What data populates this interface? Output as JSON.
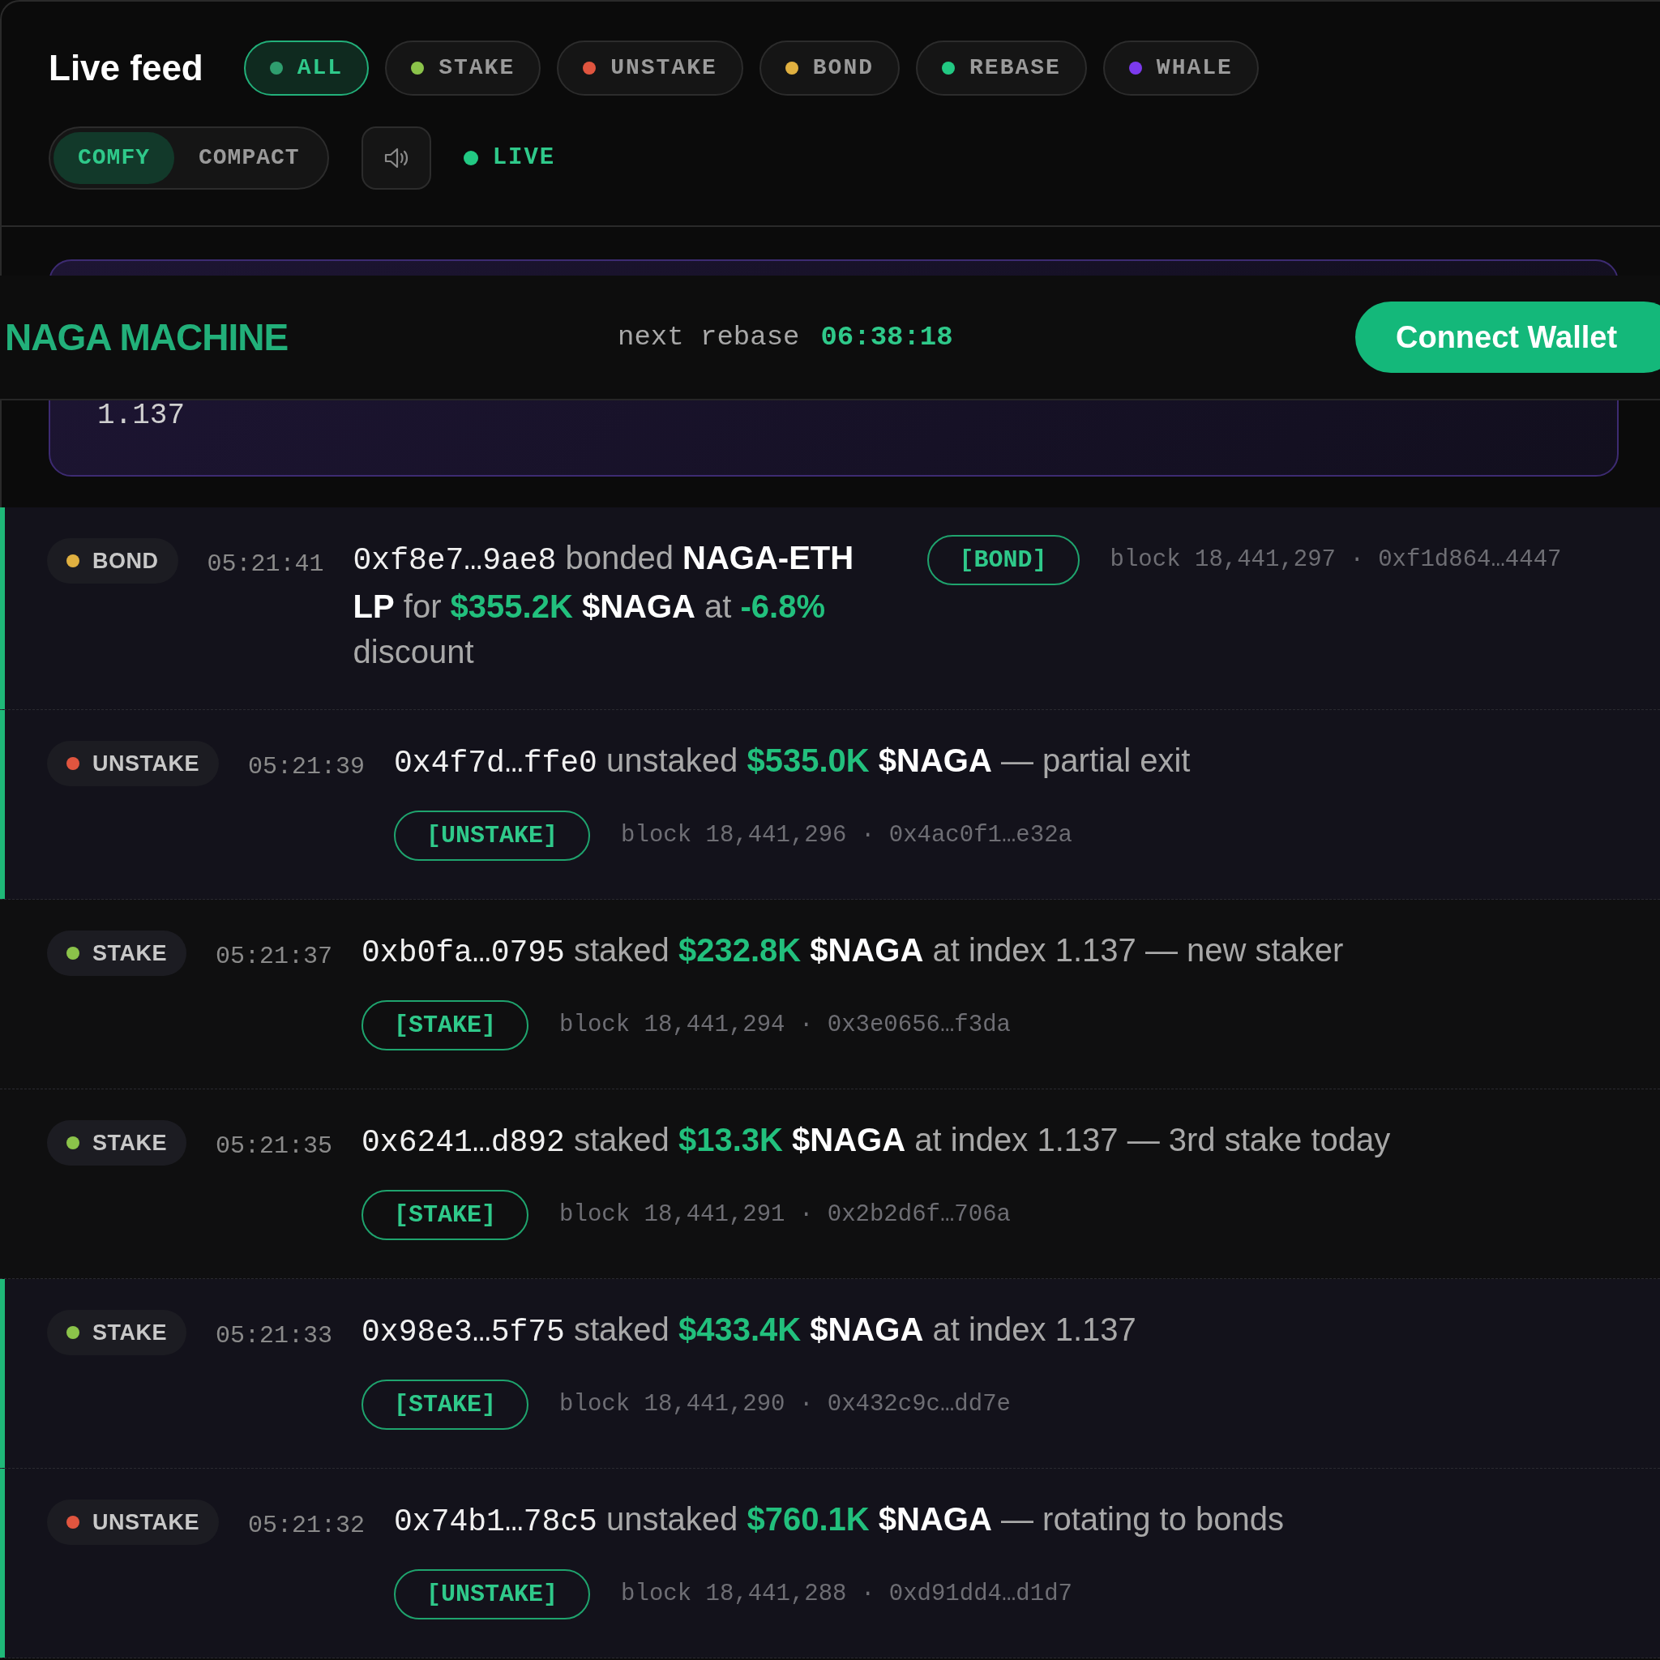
{
  "header": {
    "title": "Live feed",
    "filters": [
      {
        "label": "ALL",
        "color": "#2f9e6e",
        "selected": true
      },
      {
        "label": "STAKE",
        "color": "#8bc34a",
        "selected": false
      },
      {
        "label": "UNSTAKE",
        "color": "#e0553f",
        "selected": false
      },
      {
        "label": "BOND",
        "color": "#e0b040",
        "selected": false
      },
      {
        "label": "REBASE",
        "color": "#22c983",
        "selected": false
      },
      {
        "label": "WHALE",
        "color": "#7c3aed",
        "selected": false
      }
    ],
    "density": [
      {
        "label": "COMFY",
        "selected": true
      },
      {
        "label": "COMPACT",
        "selected": false
      }
    ],
    "live": {
      "label": "LIVE",
      "on": true
    }
  },
  "topbar": {
    "brand": "NAGA MACHINE",
    "rebase_label": "next rebase",
    "rebase_time": "06:38:18",
    "button": "Connect Wallet"
  },
  "index_card": {
    "value": "1.137"
  },
  "events": [
    {
      "type": "BOND",
      "color": "#e0b040",
      "time": "05:21:41",
      "highlighted": true,
      "kind": "inline",
      "tag": "[BOND]",
      "meta": "block 18,441,297 · 0xf1d864…4447",
      "parts": [
        {
          "kind": "addr",
          "text": "0xf8e7…9ae8"
        },
        {
          "kind": "text",
          "text": " bonded "
        },
        {
          "kind": "strong",
          "text": "NAGA-ETH LP"
        },
        {
          "kind": "text",
          "text": " for "
        },
        {
          "kind": "amount",
          "text": "$355.2K"
        },
        {
          "kind": "strong",
          "text": " $NAGA"
        },
        {
          "kind": "text",
          "text": " at "
        },
        {
          "kind": "amount",
          "text": "-6.8%"
        },
        {
          "kind": "text",
          "text": " discount"
        }
      ]
    },
    {
      "type": "UNSTAKE",
      "color": "#e0553f",
      "time": "05:21:39",
      "highlighted": true,
      "kind": "stacked",
      "tag": "[UNSTAKE]",
      "meta": "block 18,441,296 · 0x4ac0f1…e32a",
      "parts": [
        {
          "kind": "addr",
          "text": "0x4f7d…ffe0"
        },
        {
          "kind": "text",
          "text": " unstaked "
        },
        {
          "kind": "amount",
          "text": "$535.0K"
        },
        {
          "kind": "strong",
          "text": " $NAGA"
        },
        {
          "kind": "text",
          "text": " — partial exit"
        }
      ]
    },
    {
      "type": "STAKE",
      "color": "#8bc34a",
      "time": "05:21:37",
      "highlighted": false,
      "kind": "stacked",
      "tag": "[STAKE]",
      "meta": "block 18,441,294 · 0x3e0656…f3da",
      "parts": [
        {
          "kind": "addr",
          "text": "0xb0fa…0795"
        },
        {
          "kind": "text",
          "text": " staked "
        },
        {
          "kind": "amount",
          "text": "$232.8K"
        },
        {
          "kind": "strong",
          "text": " $NAGA"
        },
        {
          "kind": "text",
          "text": " at index 1.137 — new staker"
        }
      ]
    },
    {
      "type": "STAKE",
      "color": "#8bc34a",
      "time": "05:21:35",
      "highlighted": false,
      "kind": "stacked",
      "tag": "[STAKE]",
      "meta": "block 18,441,291 · 0x2b2d6f…706a",
      "parts": [
        {
          "kind": "addr",
          "text": "0x6241…d892"
        },
        {
          "kind": "text",
          "text": " staked "
        },
        {
          "kind": "amount",
          "text": "$13.3K"
        },
        {
          "kind": "strong",
          "text": " $NAGA"
        },
        {
          "kind": "text",
          "text": " at index 1.137 — 3rd stake today"
        }
      ]
    },
    {
      "type": "STAKE",
      "color": "#8bc34a",
      "time": "05:21:33",
      "highlighted": true,
      "kind": "stacked",
      "tag": "[STAKE]",
      "meta": "block 18,441,290 · 0x432c9c…dd7e",
      "parts": [
        {
          "kind": "addr",
          "text": "0x98e3…5f75"
        },
        {
          "kind": "text",
          "text": " staked "
        },
        {
          "kind": "amount",
          "text": "$433.4K"
        },
        {
          "kind": "strong",
          "text": " $NAGA"
        },
        {
          "kind": "text",
          "text": " at index 1.137"
        }
      ]
    },
    {
      "type": "UNSTAKE",
      "color": "#e0553f",
      "time": "05:21:32",
      "highlighted": true,
      "kind": "stacked",
      "tag": "[UNSTAKE]",
      "meta": "block 18,441,288 · 0xd91dd4…d1d7",
      "parts": [
        {
          "kind": "addr",
          "text": "0x74b1…78c5"
        },
        {
          "kind": "text",
          "text": " unstaked "
        },
        {
          "kind": "amount",
          "text": "$760.1K"
        },
        {
          "kind": "strong",
          "text": " $NAGA"
        },
        {
          "kind": "text",
          "text": " — rotating to bonds"
        }
      ]
    }
  ]
}
